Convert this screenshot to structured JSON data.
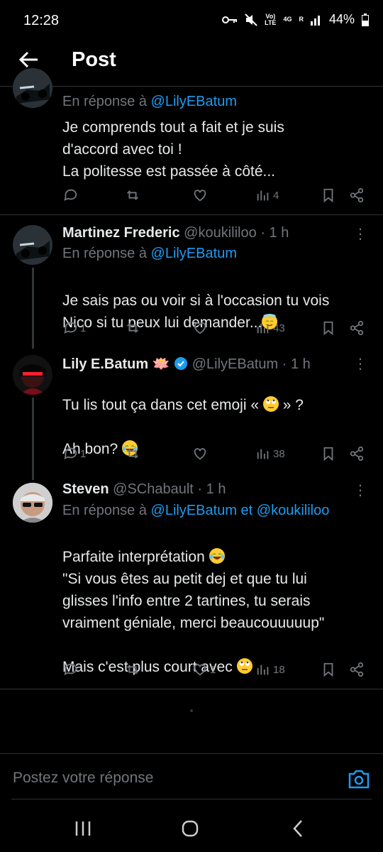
{
  "status": {
    "time": "12:28",
    "lte": "Vo)\nLTE",
    "net": "4G",
    "r": "R",
    "battery": "44%"
  },
  "header": {
    "title": "Post"
  },
  "posts": [
    {
      "reply_prefix": "En réponse à ",
      "reply_to": "@LilyEBatum",
      "body": "Je comprends tout a fait et je suis\nd'accord avec toi !\nLa politesse est passée à côté...",
      "replies": "",
      "reposts": "",
      "likes": "",
      "views": "4"
    },
    {
      "name": "Martinez Frederic",
      "handle": "@koukililoo",
      "time": "· 1 h",
      "reply_prefix": "En réponse à ",
      "reply_to": "@LilyEBatum",
      "body_a": "Je sais pas ou voir si à l'occasion tu vois",
      "body_b": "Nico si tu peux lui demander...",
      "replies": "1",
      "reposts": "",
      "likes": "",
      "views": "43"
    },
    {
      "name": "Lily E.Batum",
      "name_emoji": "🪷",
      "handle": "@LilyEBatum",
      "time": "· 1 h",
      "body_a": "Tu lis tout ça dans cet emoji « ",
      "body_b": " » ?",
      "body_c": "Ah bon? ",
      "replies": "1",
      "reposts": "",
      "likes": "",
      "views": "38"
    },
    {
      "name": "Steven",
      "handle": "@SChabault",
      "time": "· 1 h",
      "reply_prefix": "En réponse à ",
      "reply_to": "@LilyEBatum",
      "reply_and": " et ",
      "reply_to2": "@koukililoo",
      "body_a": "Parfaite interprétation ",
      "body_b": "\"Si vous êtes au petit dej et que  tu lui\nglisses l'info entre 2 tartines, tu serais\nvraiment géniale, merci beaucouuuuup\"",
      "body_c": "Mais c'est plus court avec ",
      "replies": "",
      "reposts": "",
      "likes": "1",
      "views": "18"
    }
  ],
  "compose": {
    "placeholder": "Postez votre réponse"
  },
  "colors": {
    "accent": "#1d9bf0",
    "muted": "#71767b",
    "background": "#000000"
  }
}
